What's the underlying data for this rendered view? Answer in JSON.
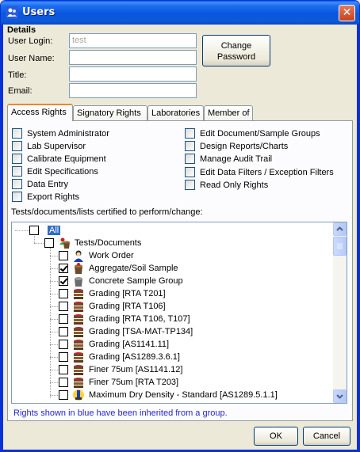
{
  "window": {
    "title": "Users",
    "close_glyph": "✕"
  },
  "details": {
    "heading": "Details",
    "login_label": "User Login:",
    "login_value": "test",
    "name_label": "User Name:",
    "name_value": "",
    "title_label": "Title:",
    "title_value": "",
    "email_label": "Email:",
    "email_value": "",
    "change_password_line1": "Change",
    "change_password_line2": "Password"
  },
  "tabs": [
    {
      "label": "Access Rights",
      "active": true
    },
    {
      "label": "Signatory Rights",
      "active": false
    },
    {
      "label": "Laboratories",
      "active": false
    },
    {
      "label": "Member of",
      "active": false
    }
  ],
  "rights_left": [
    {
      "label": "System Administrator",
      "checked": false
    },
    {
      "label": "Lab Supervisor",
      "checked": false
    },
    {
      "label": "Calibrate Equipment",
      "checked": false
    },
    {
      "label": "Edit Specifications",
      "checked": false
    },
    {
      "label": "Data Entry",
      "checked": false
    },
    {
      "label": "Export Rights",
      "checked": false
    }
  ],
  "rights_right": [
    {
      "label": "Edit Document/Sample Groups",
      "checked": false
    },
    {
      "label": "Design Reports/Charts",
      "checked": false
    },
    {
      "label": "Manage Audit Trail",
      "checked": false
    },
    {
      "label": "Edit Data Filters / Exception Filters",
      "checked": false
    },
    {
      "label": "Read Only Rights",
      "checked": false
    }
  ],
  "tests_label": "Tests/documents/lists certified to perform/change:",
  "tree": {
    "root": {
      "label": "All",
      "checked": false
    },
    "group": {
      "label": "Tests/Documents",
      "checked": false
    },
    "items": [
      {
        "label": "Work Order",
        "checked": false,
        "icon": "person-icon"
      },
      {
        "label": "Aggregate/Soil Sample",
        "checked": true,
        "icon": "bucket-icon"
      },
      {
        "label": "Concrete Sample Group",
        "checked": true,
        "icon": "bucket-icon"
      },
      {
        "label": "Grading [RTA T201]",
        "checked": false,
        "icon": "sieve-icon"
      },
      {
        "label": "Grading [RTA T106]",
        "checked": false,
        "icon": "sieve-icon"
      },
      {
        "label": "Grading [RTA T106, T107]",
        "checked": false,
        "icon": "sieve-icon"
      },
      {
        "label": "Grading [TSA-MAT-TP134]",
        "checked": false,
        "icon": "sieve-icon"
      },
      {
        "label": "Grading [AS1141.11]",
        "checked": false,
        "icon": "sieve-icon"
      },
      {
        "label": "Grading [AS1289.3.6.1]",
        "checked": false,
        "icon": "sieve-icon"
      },
      {
        "label": "Finer 75um [AS1141.12]",
        "checked": false,
        "icon": "sieve-icon"
      },
      {
        "label": "Finer 75um [RTA T203]",
        "checked": false,
        "icon": "sieve-icon"
      },
      {
        "label": "Maximum Dry Density - Standard [AS1289.5.1.1]",
        "checked": false,
        "icon": "hammer-icon"
      }
    ]
  },
  "inherit_note": "Rights shown in blue have been inherited from a group.",
  "buttons": {
    "ok": "OK",
    "cancel": "Cancel"
  },
  "colors": {
    "titlebar": "#0a56e0",
    "dialog_bg": "#ece9d8",
    "selection": "#316ac5",
    "inherit_text": "#2525d0",
    "active_tab_accent": "#e68b2c"
  }
}
